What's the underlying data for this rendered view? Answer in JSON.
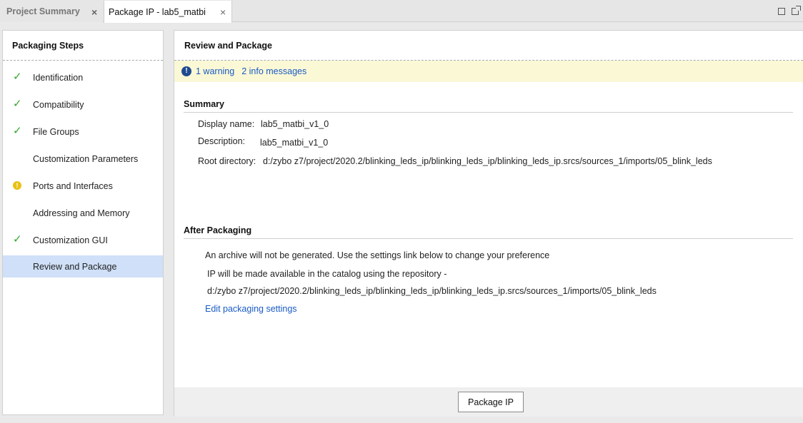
{
  "tabs": [
    {
      "label": "Project Summary",
      "close": "×"
    },
    {
      "label": "Package IP - lab5_matbi",
      "close": "×"
    }
  ],
  "window_icons": [
    "maximize-icon",
    "float-icon"
  ],
  "steps_panel": {
    "title": "Packaging Steps",
    "items": [
      {
        "label": "Identification",
        "status": "check"
      },
      {
        "label": "Compatibility",
        "status": "check"
      },
      {
        "label": "File Groups",
        "status": "check"
      },
      {
        "label": "Customization Parameters",
        "status": "none"
      },
      {
        "label": "Ports and Interfaces",
        "status": "warning"
      },
      {
        "label": "Addressing and Memory",
        "status": "none"
      },
      {
        "label": "Customization GUI",
        "status": "check"
      },
      {
        "label": "Review and Package",
        "status": "none",
        "selected": true
      }
    ]
  },
  "main": {
    "title": "Review and Package",
    "messages": {
      "icon": "!",
      "warning_link": "1 warning",
      "info_link": "2 info messages"
    },
    "summary": {
      "heading": "Summary",
      "display_name_label": "Display name:",
      "display_name_value": "lab5_matbi_v1_0",
      "description_label": "Description:",
      "description_value": "lab5_matbi_v1_0",
      "root_dir_label": "Root directory:",
      "root_dir_value": "d:/zybo z7/project/2020.2/blinking_leds_ip/blinking_leds_ip/blinking_leds_ip.srcs/sources_1/imports/05_blink_leds"
    },
    "after_packaging": {
      "heading": "After Packaging",
      "line1": "An archive will not be generated. Use the settings link below to change your preference",
      "line2": "IP will be made available in the catalog using the repository -",
      "line3": "d:/zybo z7/project/2020.2/blinking_leds_ip/blinking_leds_ip/blinking_leds_ip.srcs/sources_1/imports/05_blink_leds",
      "settings_link": "Edit packaging settings"
    },
    "package_button": "Package IP"
  },
  "colors": {
    "accent_link": "#1a5bc4",
    "check": "#2fa82f",
    "warning": "#e8c214",
    "selected_bg": "#cfe0f8",
    "message_bar_bg": "#fbf8d6"
  }
}
